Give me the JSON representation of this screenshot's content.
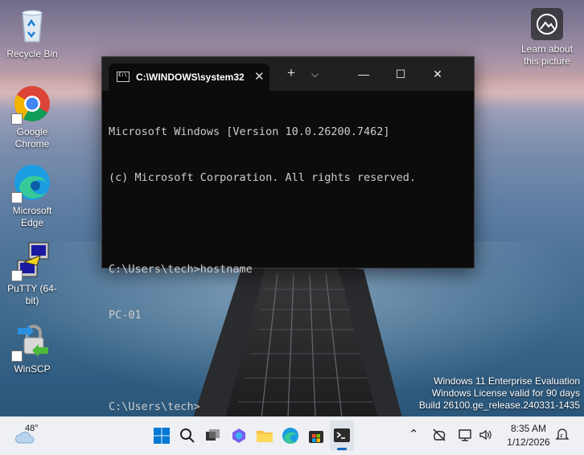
{
  "desktop": {
    "icons": [
      {
        "label": "Recycle Bin"
      },
      {
        "label": "Google Chrome"
      },
      {
        "label": "Microsoft Edge"
      },
      {
        "label": "PuTTY (64-bit)"
      },
      {
        "label": "WinSCP"
      }
    ],
    "spotlight": {
      "line1": "Learn about",
      "line2": "this picture"
    },
    "watermark": {
      "line1": "Windows 11 Enterprise Evaluation",
      "line2": "Windows License valid for 90 days",
      "line3": "Build 26100.ge_release.240331-1435"
    }
  },
  "terminal": {
    "tab_title": "C:\\WINDOWS\\system32",
    "lines": [
      "Microsoft Windows [Version 10.0.26200.7462]",
      "(c) Microsoft Corporation. All rights reserved.",
      "",
      "C:\\Users\\tech>hostname",
      "PC-01",
      "",
      "C:\\Users\\tech>"
    ]
  },
  "taskbar": {
    "weather_temp": "48°",
    "time": "8:35 AM",
    "date": "1/12/2026"
  },
  "colors": {
    "terminal_bg": "#0c0c0c",
    "terminal_bar": "#202020",
    "taskbar_bg": "#eef0f4",
    "windows_blue": "#0078d4"
  }
}
